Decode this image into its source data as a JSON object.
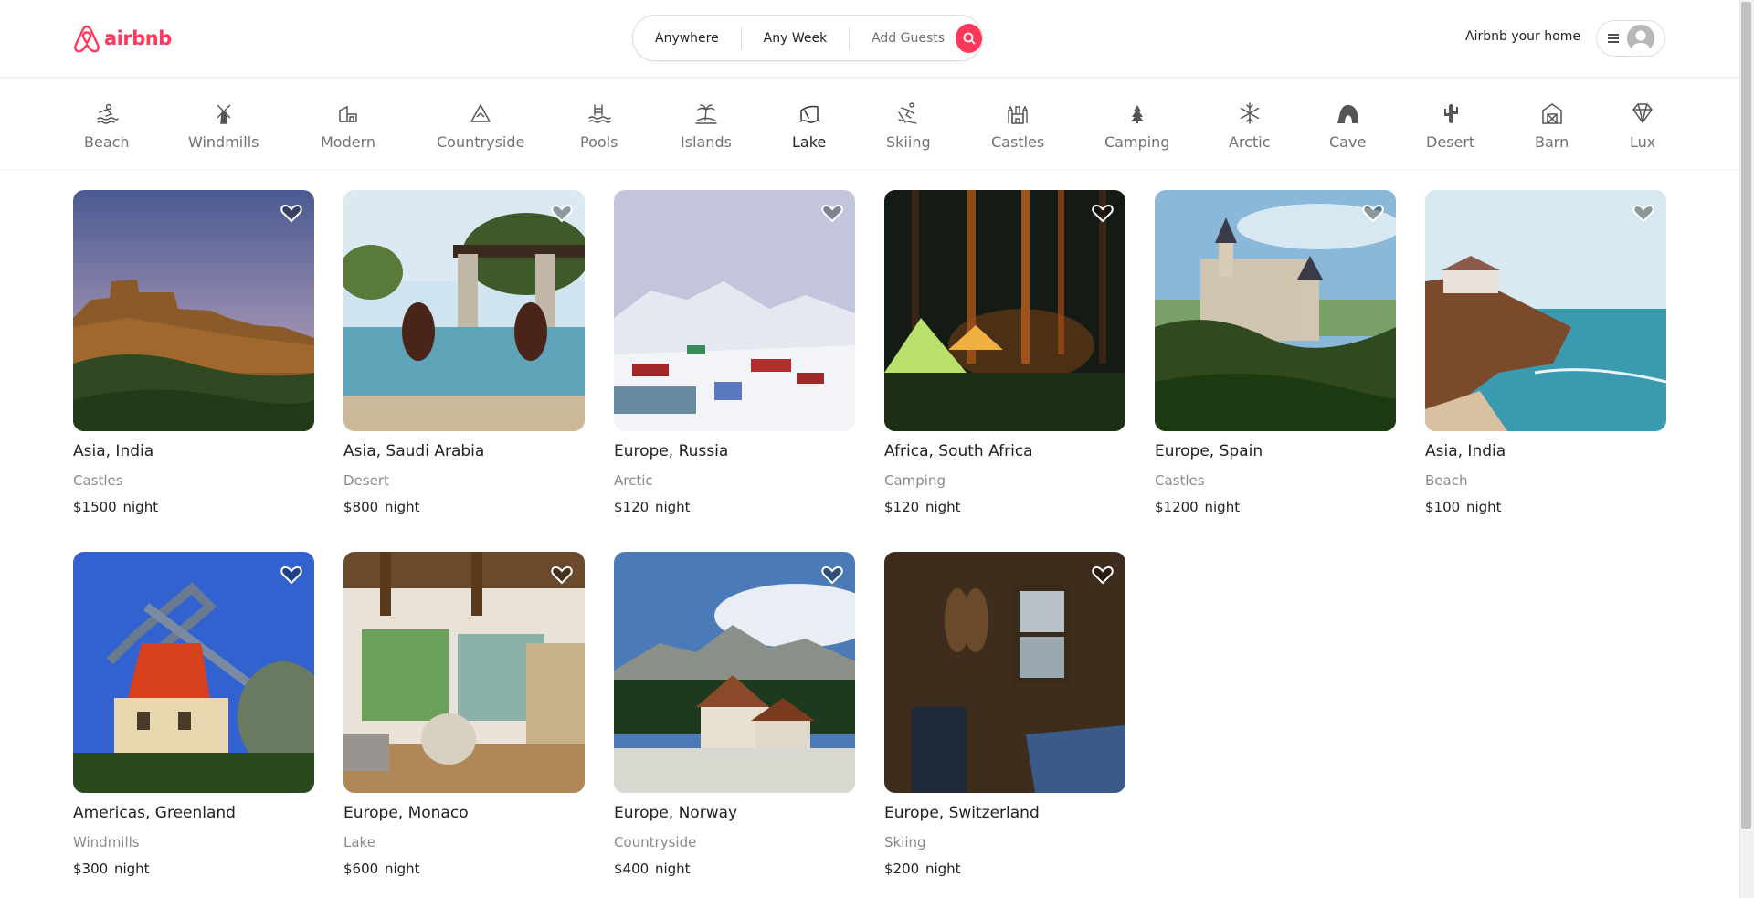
{
  "brand": {
    "name": "airbnb",
    "color": "#ff385c"
  },
  "search": {
    "where": "Anywhere",
    "when": "Any Week",
    "guests": "Add Guests",
    "icon": "search-icon"
  },
  "header": {
    "host_link": "Airbnb your home",
    "menu_icon": "hamburger-icon",
    "avatar_icon": "user-avatar-icon"
  },
  "categories": [
    {
      "label": "Beach",
      "icon": "beach-icon"
    },
    {
      "label": "Windmills",
      "icon": "windmill-icon"
    },
    {
      "label": "Modern",
      "icon": "modern-house-icon"
    },
    {
      "label": "Countryside",
      "icon": "mountain-icon"
    },
    {
      "label": "Pools",
      "icon": "pool-icon"
    },
    {
      "label": "Islands",
      "icon": "island-icon"
    },
    {
      "label": "Lake",
      "icon": "lake-icon"
    },
    {
      "label": "Skiing",
      "icon": "skiing-icon"
    },
    {
      "label": "Castles",
      "icon": "castle-icon"
    },
    {
      "label": "Camping",
      "icon": "camping-icon"
    },
    {
      "label": "Arctic",
      "icon": "snowflake-icon"
    },
    {
      "label": "Cave",
      "icon": "cave-icon"
    },
    {
      "label": "Desert",
      "icon": "cactus-icon"
    },
    {
      "label": "Barn",
      "icon": "barn-icon"
    },
    {
      "label": "Lux",
      "icon": "diamond-icon"
    }
  ],
  "listings": [
    {
      "location": "Asia, India",
      "category": "Castles",
      "price": "$1500",
      "unit": "night",
      "scene": "fort"
    },
    {
      "location": "Asia, Saudi Arabia",
      "category": "Desert",
      "price": "$800",
      "unit": "night",
      "scene": "pool"
    },
    {
      "location": "Europe, Russia",
      "category": "Arctic",
      "price": "$120",
      "unit": "night",
      "scene": "snow"
    },
    {
      "location": "Africa, South Africa",
      "category": "Camping",
      "price": "$120",
      "unit": "night",
      "scene": "camp"
    },
    {
      "location": "Europe, Spain",
      "category": "Castles",
      "price": "$1200",
      "unit": "night",
      "scene": "castle"
    },
    {
      "location": "Asia, India",
      "category": "Beach",
      "price": "$100",
      "unit": "night",
      "scene": "beach"
    },
    {
      "location": "Americas, Greenland",
      "category": "Windmills",
      "price": "$300",
      "unit": "night",
      "scene": "windmill"
    },
    {
      "location": "Europe, Monaco",
      "category": "Lake",
      "price": "$600",
      "unit": "night",
      "scene": "interior"
    },
    {
      "location": "Europe, Norway",
      "category": "Countryside",
      "price": "$400",
      "unit": "night",
      "scene": "chalet"
    },
    {
      "location": "Europe, Switzerland",
      "category": "Skiing",
      "price": "$200",
      "unit": "night",
      "scene": "cabin"
    }
  ]
}
